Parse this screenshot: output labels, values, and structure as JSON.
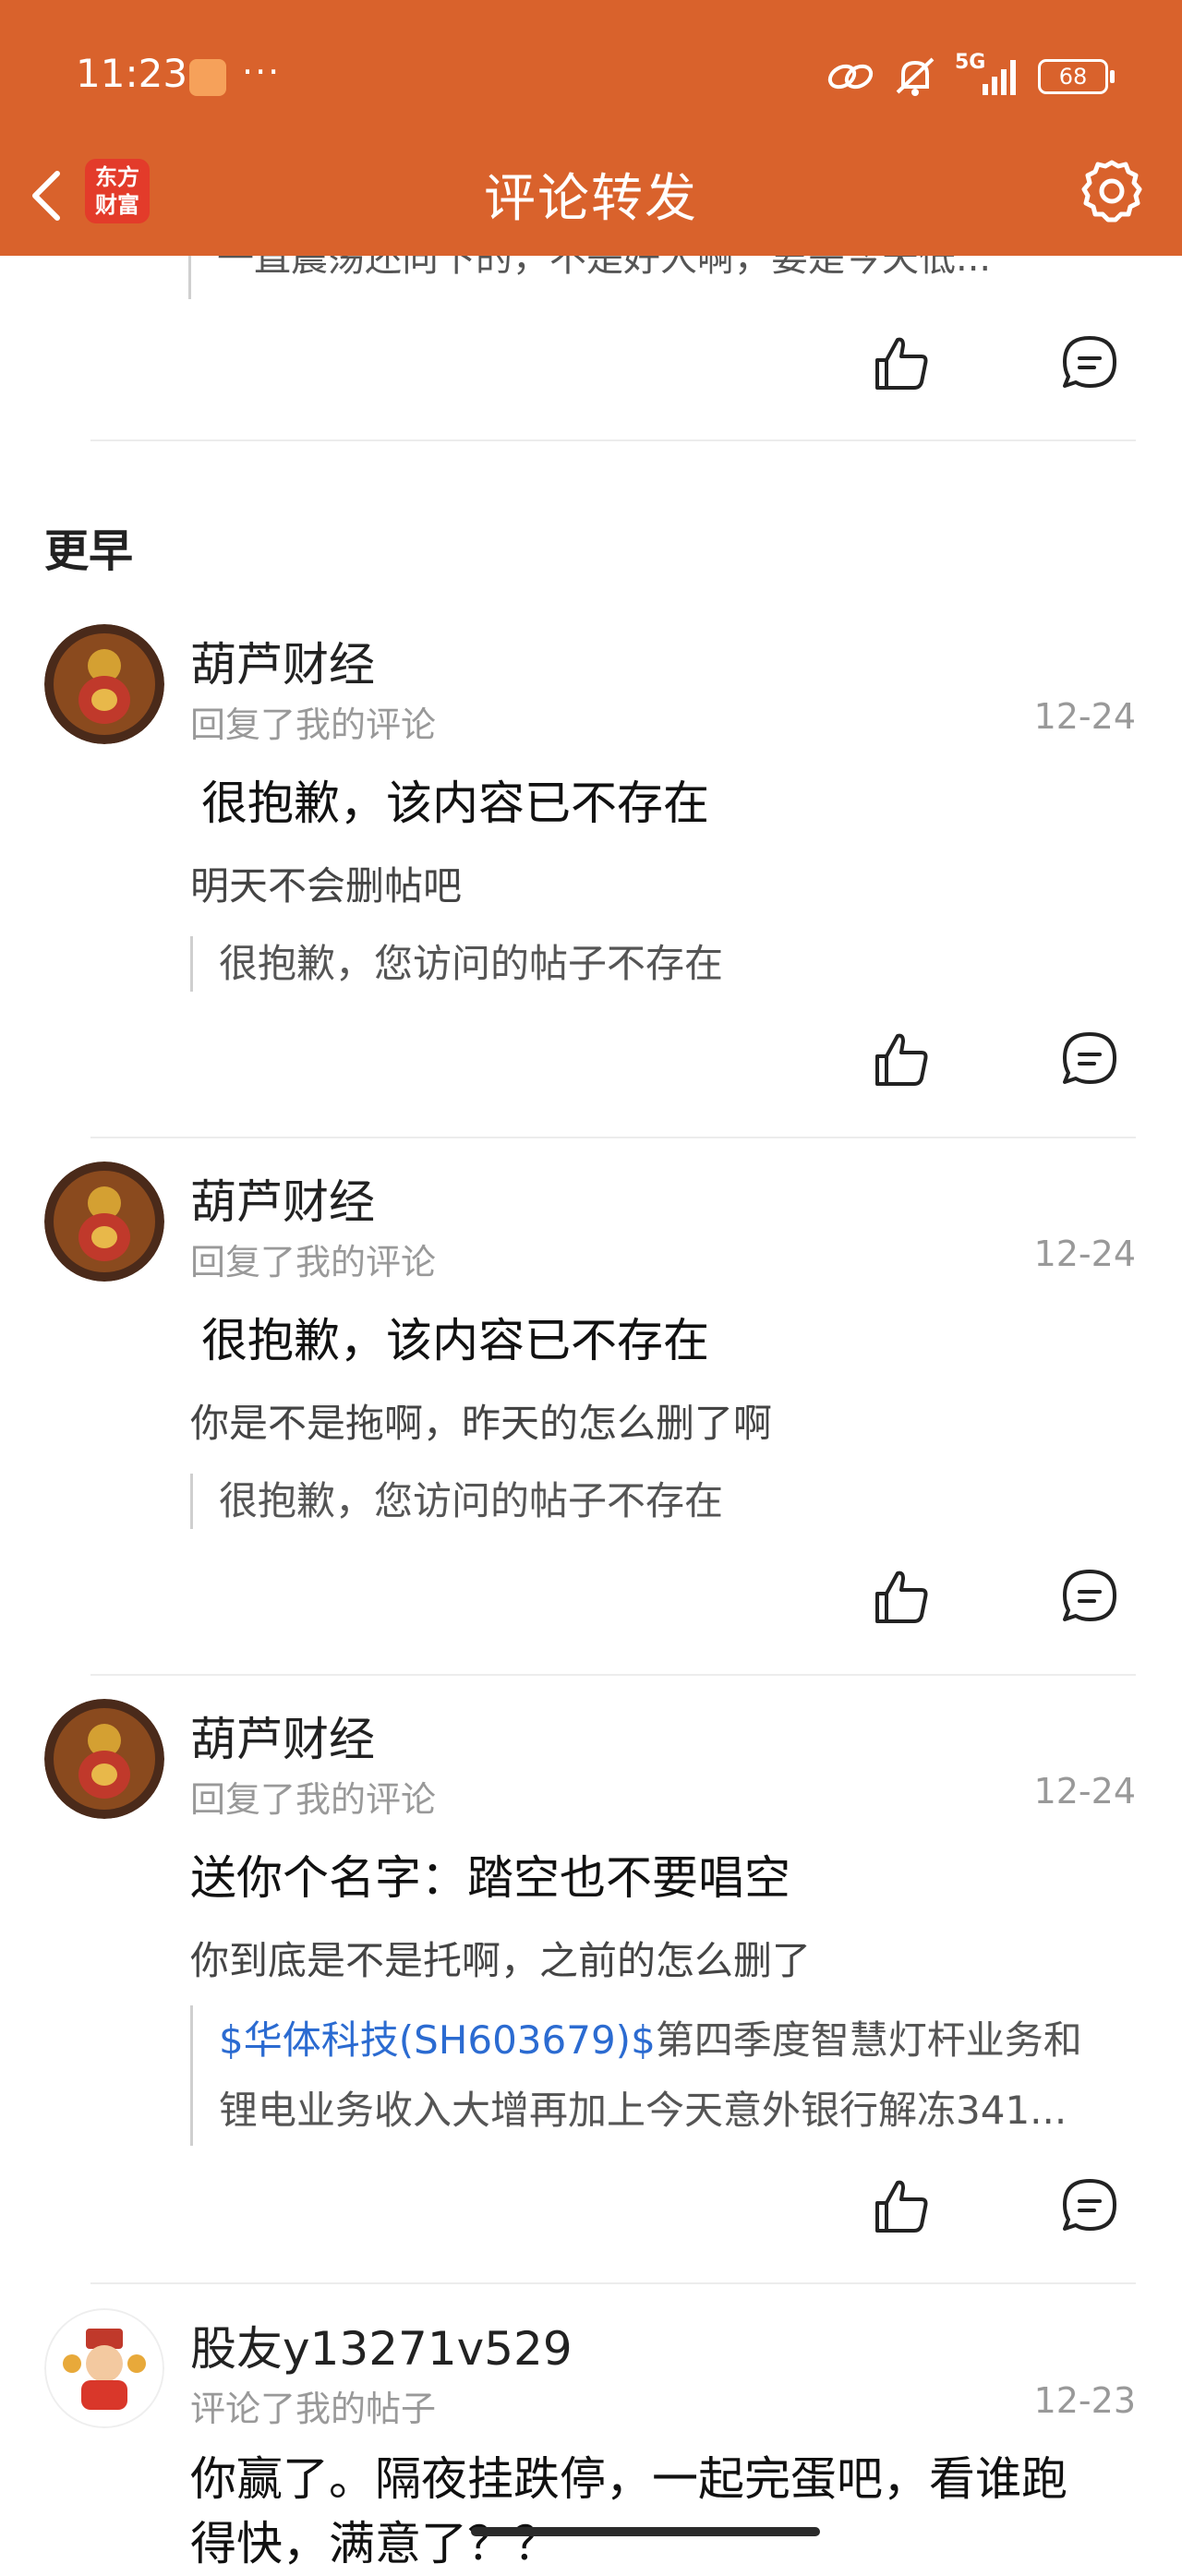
{
  "status_bar": {
    "time": "11:23",
    "dots": "···",
    "network": "5G",
    "battery": "68"
  },
  "header": {
    "logo_line1": "东方",
    "logo_line2": "财富",
    "title": "评论转发"
  },
  "partial_item": {
    "quote": "一直震荡还向下的，不是好人啊，要是今天低..."
  },
  "section": {
    "title": "更早"
  },
  "items": [
    {
      "username": "葫芦财经",
      "action": "回复了我的评论",
      "date": "12-24",
      "headline": "很抱歉，该内容已不存在",
      "reply": "明天不会删帖吧",
      "quote": "很抱歉，您访问的帖子不存在"
    },
    {
      "username": "葫芦财经",
      "action": "回复了我的评论",
      "date": "12-24",
      "headline": "很抱歉，该内容已不存在",
      "reply": "你是不是拖啊，昨天的怎么删了啊",
      "quote": "很抱歉，您访问的帖子不存在"
    },
    {
      "username": "葫芦财经",
      "action": "回复了我的评论",
      "date": "12-24",
      "headline": "送你个名字：踏空也不要唱空",
      "reply": "你到底是不是托啊，之前的怎么删了",
      "quote_tag": "$华体科技(SH603679)$",
      "quote_line1": "第四季度智慧灯杆业务和",
      "quote_line2": "锂电业务收入大增再加上今天意外银行解冻341..."
    },
    {
      "username": "股友y13271v529",
      "action": "评论了我的帖子",
      "date": "12-23",
      "headline_line1": "你赢了。隔夜挂跌停，一起完蛋吧，看谁跑",
      "headline_line2": "得快，满意了？？"
    }
  ],
  "colors": {
    "header": "#d9622c",
    "link": "#2b6bd1",
    "muted": "#999999"
  }
}
